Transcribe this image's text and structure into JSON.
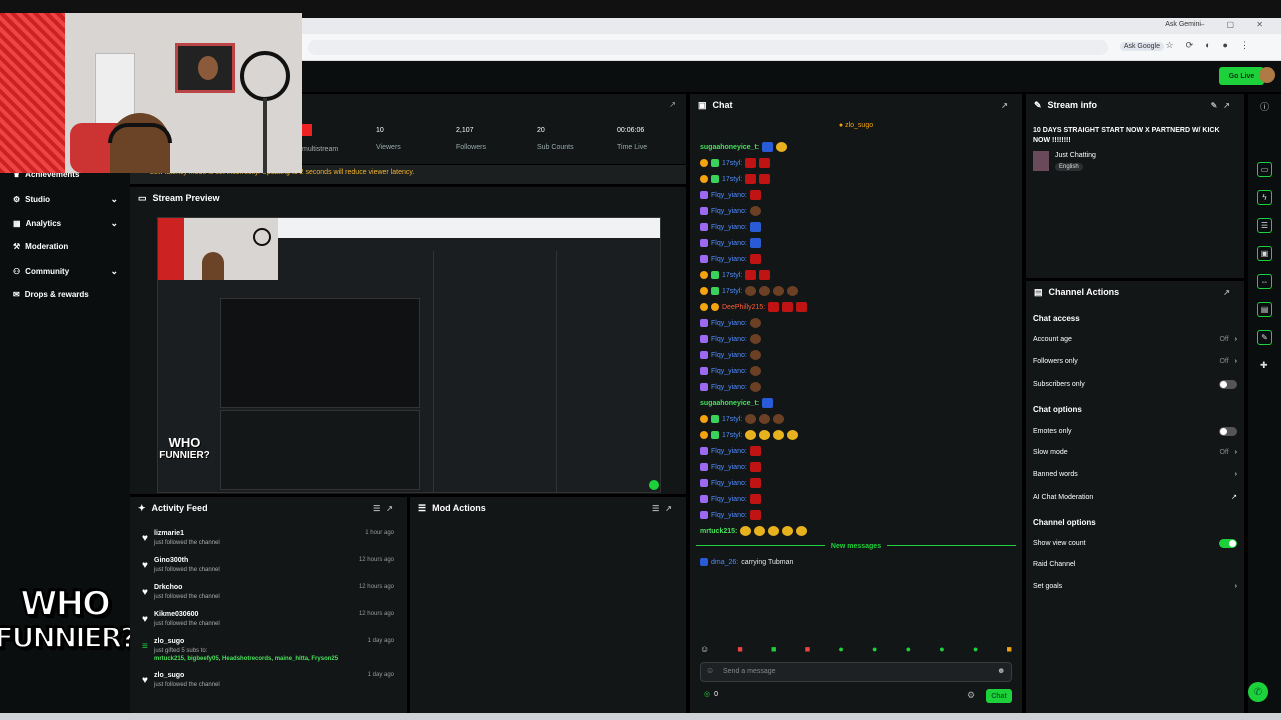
{
  "browser": {
    "ask_gemini": "Ask Gemini",
    "ask_google": "Ask Google"
  },
  "header": {
    "go_live": "Go Live"
  },
  "sidebar": {
    "items": [
      {
        "label": "Achievements",
        "chevron": false
      },
      {
        "label": "Studio",
        "chevron": true
      },
      {
        "label": "Analytics",
        "chevron": true
      },
      {
        "label": "Moderation",
        "chevron": false
      },
      {
        "label": "Community",
        "chevron": true
      },
      {
        "label": "Drops & rewards",
        "chevron": false
      }
    ]
  },
  "overlay": {
    "line1": "WHO",
    "line2": "FUNNIER?"
  },
  "stats": {
    "multistream": "multistream",
    "viewers": {
      "value": "10",
      "label": "Viewers"
    },
    "followers": {
      "value": "2,107",
      "label": "Followers"
    },
    "subs": {
      "value": "20",
      "label": "Sub Counts"
    },
    "time": {
      "value": "00:06:06",
      "label": "Time Live"
    }
  },
  "latency_notice": "Low latency mode is set incorrectly. Updating to 2 seconds will reduce viewer latency.",
  "preview": {
    "title": "Stream Preview",
    "overlay_line1": "WHO",
    "overlay_line2": "FUNNIER?"
  },
  "activity": {
    "title": "Activity Feed",
    "items": [
      {
        "name": "lizmarie1",
        "text": "just followed the channel",
        "time": "1 hour ago",
        "icon": "heart-icon"
      },
      {
        "name": "Gino300th",
        "text": "just followed the channel",
        "time": "12 hours ago",
        "icon": "heart-icon"
      },
      {
        "name": "Drkchoo",
        "text": "just followed the channel",
        "time": "12 hours ago",
        "icon": "heart-icon"
      },
      {
        "name": "Kikme030600",
        "text": "just followed the channel",
        "time": "12 hours ago",
        "icon": "heart-icon"
      },
      {
        "name": "zlo_sugo",
        "text": "just gifted 5 subs to:",
        "extra": "mrtuck215, bigbeefy05, Headshotrecords, maine_hitta, Fryson25",
        "time": "1 day ago",
        "icon": "gift-icon"
      },
      {
        "name": "zlo_sugo",
        "text": "just followed the channel",
        "time": "1 day ago",
        "icon": "heart-icon"
      }
    ]
  },
  "mod_actions": {
    "title": "Mod Actions"
  },
  "chat": {
    "title": "Chat",
    "pinned_user": "zlo_sugo",
    "messages": [
      {
        "user": "sugaahoneyice_t:",
        "color": "green",
        "badges": [],
        "emotes": [
          "eb",
          "ey"
        ]
      },
      {
        "user": "17styl:",
        "color": "blue",
        "badges": [
          "bo",
          "bg"
        ],
        "emotes": [
          "er",
          "er"
        ]
      },
      {
        "user": "17styl:",
        "color": "blue",
        "badges": [
          "bo",
          "bg"
        ],
        "emotes": [
          "er",
          "er"
        ]
      },
      {
        "user": "Flqy_yiano:",
        "color": "blue",
        "badges": [
          "bp"
        ],
        "emotes": [
          "er"
        ]
      },
      {
        "user": "Flqy_yiano:",
        "color": "blue",
        "badges": [
          "bp"
        ],
        "emotes": [
          "ebr"
        ]
      },
      {
        "user": "Flqy_yiano:",
        "color": "blue",
        "badges": [
          "bp"
        ],
        "emotes": [
          "eb"
        ]
      },
      {
        "user": "Flqy_yiano:",
        "color": "blue",
        "badges": [
          "bp"
        ],
        "emotes": [
          "eb"
        ]
      },
      {
        "user": "Flqy_yiano:",
        "color": "blue",
        "badges": [
          "bp"
        ],
        "emotes": [
          "er"
        ]
      },
      {
        "user": "17styl:",
        "color": "blue",
        "badges": [
          "bo",
          "bg"
        ],
        "emotes": [
          "er",
          "er"
        ]
      },
      {
        "user": "17styl:",
        "color": "blue",
        "badges": [
          "bo",
          "bg"
        ],
        "emotes": [
          "ebr",
          "ebr",
          "ebr",
          "ebr"
        ]
      },
      {
        "user": "DeePhilly215:",
        "color": "red",
        "badges": [
          "bo",
          "bo"
        ],
        "emotes": [
          "er",
          "er",
          "er"
        ]
      },
      {
        "user": "Flqy_yiano:",
        "color": "blue",
        "badges": [
          "bp"
        ],
        "emotes": [
          "ebr"
        ]
      },
      {
        "user": "Flqy_yiano:",
        "color": "blue",
        "badges": [
          "bp"
        ],
        "emotes": [
          "ebr"
        ]
      },
      {
        "user": "Flqy_yiano:",
        "color": "blue",
        "badges": [
          "bp"
        ],
        "emotes": [
          "ebr"
        ]
      },
      {
        "user": "Flqy_yiano:",
        "color": "blue",
        "badges": [
          "bp"
        ],
        "emotes": [
          "ebr"
        ]
      },
      {
        "user": "Flqy_yiano:",
        "color": "blue",
        "badges": [
          "bp"
        ],
        "emotes": [
          "ebr"
        ]
      },
      {
        "user": "sugaahoneyice_t:",
        "color": "green",
        "badges": [],
        "emotes": [
          "eb"
        ]
      },
      {
        "user": "17styl:",
        "color": "blue",
        "badges": [
          "bo",
          "bg"
        ],
        "emotes": [
          "ebr",
          "ebr",
          "ebr"
        ]
      },
      {
        "user": "17styl:",
        "color": "blue",
        "badges": [
          "bo",
          "bg"
        ],
        "emotes": [
          "ey",
          "ey",
          "ey",
          "ey"
        ]
      },
      {
        "user": "Flqy_yiano:",
        "color": "blue",
        "badges": [
          "bp"
        ],
        "emotes": [
          "er"
        ]
      },
      {
        "user": "Flqy_yiano:",
        "color": "blue",
        "badges": [
          "bp"
        ],
        "emotes": [
          "er"
        ]
      },
      {
        "user": "Flqy_yiano:",
        "color": "blue",
        "badges": [
          "bp"
        ],
        "emotes": [
          "er"
        ]
      },
      {
        "user": "Flqy_yiano:",
        "color": "blue",
        "badges": [
          "bp"
        ],
        "emotes": [
          "er"
        ]
      },
      {
        "user": "Flqy_yiano:",
        "color": "blue",
        "badges": [
          "bp"
        ],
        "emotes": [
          "er"
        ]
      },
      {
        "user": "mrtuck215:",
        "color": "green",
        "badges": [],
        "emotes": [
          "ey",
          "ey",
          "ey",
          "ey",
          "ey"
        ]
      }
    ],
    "new_messages": "New messages",
    "last_user": "dma_26:",
    "last_text": "carrying Tubman",
    "input_placeholder": "Send a message",
    "viewers_count": "0",
    "send_label": "Chat"
  },
  "stream_info": {
    "title_label": "Stream info",
    "stream_title": "10 DAYS STRAIGHT START NOW X PARTNERD W/ KICK NOW !!!!!!!!",
    "category": "Just Chatting",
    "language": "English"
  },
  "channel_actions": {
    "title": "Channel Actions",
    "chat_access": "Chat access",
    "account_age": {
      "label": "Account age",
      "value": "Off"
    },
    "followers_only": {
      "label": "Followers only",
      "value": "Off"
    },
    "subscribers_only": {
      "label": "Subscribers only"
    },
    "chat_options": "Chat options",
    "emotes_only": {
      "label": "Emotes only"
    },
    "slow_mode": {
      "label": "Slow mode",
      "value": "Off"
    },
    "banned_words": {
      "label": "Banned words"
    },
    "ai_moderation": {
      "label": "AI Chat Moderation"
    },
    "channel_options": "Channel options",
    "show_view_count": {
      "label": "Show view count"
    },
    "raid_channel": {
      "label": "Raid Channel"
    },
    "set_goals": {
      "label": "Set goals"
    }
  },
  "colors": {
    "accent": "#1dd13a",
    "panel": "#131617",
    "bg": "#0b0e0f"
  }
}
